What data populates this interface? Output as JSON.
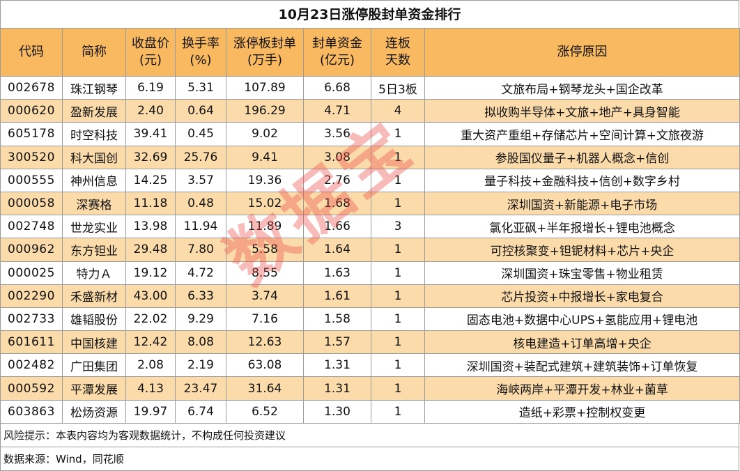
{
  "title": "10月23日涨停股封单资金排行",
  "headers": [
    "代码",
    "简称",
    "收盘价\n(元)",
    "换手率\n(%)",
    "涨停板封单\n(万手)",
    "封单资金\n(亿元)",
    "连板\n天数",
    "涨停原因"
  ],
  "rows": [
    [
      "002678",
      "珠江钢琴",
      "6.19",
      "5.31",
      "107.89",
      "6.68",
      "5日3板",
      "文旅布局+钢琴龙头+国企改革"
    ],
    [
      "000620",
      "盈新发展",
      "2.40",
      "0.64",
      "196.29",
      "4.71",
      "4",
      "拟收购半导体+文旅+地产+具身智能"
    ],
    [
      "605178",
      "时空科技",
      "39.41",
      "0.45",
      "9.02",
      "3.56",
      "1",
      "重大资产重组+存储芯片+空间计算+文旅夜游"
    ],
    [
      "300520",
      "科大国创",
      "32.69",
      "25.76",
      "9.41",
      "3.08",
      "1",
      "参股国仪量子+机器人概念+信创"
    ],
    [
      "000555",
      "神州信息",
      "14.25",
      "3.57",
      "19.36",
      "2.76",
      "1",
      "量子科技+金融科技+信创+数字乡村"
    ],
    [
      "000058",
      "深赛格",
      "11.18",
      "0.48",
      "15.02",
      "1.68",
      "1",
      "深圳国资+新能源+电子市场"
    ],
    [
      "002748",
      "世龙实业",
      "13.98",
      "11.94",
      "11.89",
      "1.66",
      "3",
      "氯化亚砜+半年报增长+锂电池概念"
    ],
    [
      "000962",
      "东方钽业",
      "29.48",
      "7.80",
      "5.58",
      "1.64",
      "1",
      "可控核聚变+钽铌材料+芯片+央企"
    ],
    [
      "000025",
      "特力Ａ",
      "19.12",
      "4.72",
      "8.55",
      "1.63",
      "1",
      "深圳国资+珠宝零售+物业租赁"
    ],
    [
      "002290",
      "禾盛新材",
      "43.00",
      "6.33",
      "3.74",
      "1.61",
      "1",
      "芯片投资+中报增长+家电复合"
    ],
    [
      "002733",
      "雄韬股份",
      "22.02",
      "9.29",
      "7.16",
      "1.58",
      "1",
      "固态电池+数据中心UPS+氢能应用+锂电池"
    ],
    [
      "601611",
      "中国核建",
      "12.42",
      "8.08",
      "12.63",
      "1.57",
      "1",
      "核电建造+订单高增+央企"
    ],
    [
      "002482",
      "广田集团",
      "2.08",
      "2.19",
      "63.08",
      "1.31",
      "1",
      "深圳国资+装配式建筑+建筑装饰+订单恢复"
    ],
    [
      "000592",
      "平潭发展",
      "4.13",
      "23.47",
      "31.64",
      "1.31",
      "1",
      "海峡两岸+平潭开发+林业+菌草"
    ],
    [
      "603863",
      "松炀资源",
      "19.97",
      "6.74",
      "6.52",
      "1.30",
      "1",
      "造纸+彩票+控制权变更"
    ]
  ],
  "footer": {
    "risk": "风险提示：本表内容均为客观数据统计，不构成任何投资建议",
    "source": "数据来源：Wind，同花顺"
  },
  "watermark": "数据宝",
  "colors": {
    "header_bg": "#f9b960",
    "alt_row_bg": "#fcdbab",
    "watermark": "#eb5046"
  }
}
